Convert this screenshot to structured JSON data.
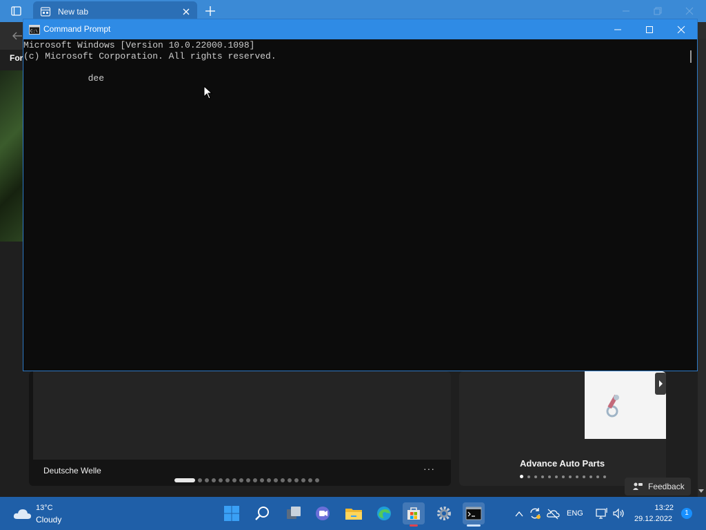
{
  "browser": {
    "tab": {
      "label": "New tab"
    },
    "feed_label": "For",
    "news_card": {
      "source": "Deutsche Welle",
      "more": "···",
      "page_count": 19,
      "active_page": 1
    },
    "ad_card": {
      "title": "Advance Auto Parts",
      "page_count": 13,
      "active_page": 1
    },
    "feedback_label": "Feedback"
  },
  "cmd": {
    "title": "Command Prompt",
    "lines": [
      "Microsoft Windows [Version 10.0.22000.1098]",
      "(c) Microsoft Corporation. All rights reserved.",
      "            dee"
    ]
  },
  "taskbar": {
    "weather": {
      "temp": "13°C",
      "condition": "Cloudy"
    },
    "apps": [
      "start-icon",
      "search-icon",
      "task-view-icon",
      "teams-chat-icon",
      "file-explorer-icon",
      "edge-icon",
      "microsoft-store-icon",
      "settings-icon",
      "terminal-icon"
    ],
    "active_app": "terminal-icon",
    "tray": {
      "lang": "ENG",
      "time": "13:22",
      "date": "29.12.2022",
      "notifications": "1"
    }
  },
  "colors": {
    "titlebar": "#2f8be5",
    "taskbar": "#1f5fa8",
    "console_bg": "#0c0c0c",
    "console_text": "#cccccc"
  }
}
